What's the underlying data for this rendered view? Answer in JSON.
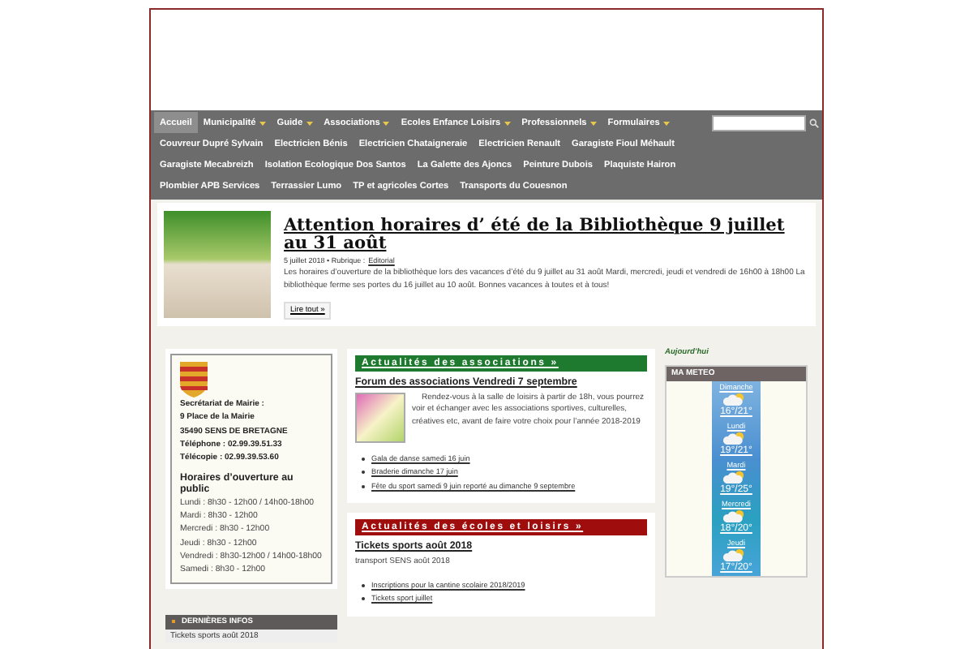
{
  "nav": {
    "rows": [
      {
        "items": [
          {
            "label": "Accueil",
            "dropdown": false,
            "selected": true
          },
          {
            "label": "Municipalité",
            "dropdown": true,
            "selected": false
          },
          {
            "label": "Guide",
            "dropdown": true,
            "selected": false
          },
          {
            "label": "Associations",
            "dropdown": true,
            "selected": false
          },
          {
            "label": "Ecoles Enfance Loisirs",
            "dropdown": true,
            "selected": false
          },
          {
            "label": "Professionnels",
            "dropdown": true,
            "selected": false
          },
          {
            "label": "Formulaires",
            "dropdown": true,
            "selected": false
          }
        ]
      },
      {
        "items": [
          {
            "label": "Couvreur Dupré Sylvain",
            "dropdown": false,
            "selected": false
          },
          {
            "label": "Electricien Bénis",
            "dropdown": false,
            "selected": false
          },
          {
            "label": "Electricien Chataigneraie",
            "dropdown": false,
            "selected": false
          },
          {
            "label": "Electricien Renault",
            "dropdown": false,
            "selected": false
          },
          {
            "label": "Garagiste Fioul Méhault",
            "dropdown": false,
            "selected": false
          }
        ]
      },
      {
        "items": [
          {
            "label": "Garagiste Mecabreizh",
            "dropdown": false,
            "selected": false
          },
          {
            "label": "Isolation Ecologique Dos Santos",
            "dropdown": false,
            "selected": false
          },
          {
            "label": "La Galette des Ajoncs",
            "dropdown": false,
            "selected": false
          },
          {
            "label": "Peinture Dubois",
            "dropdown": false,
            "selected": false
          },
          {
            "label": "Plaquiste Hairon",
            "dropdown": false,
            "selected": false
          }
        ]
      },
      {
        "items": [
          {
            "label": "Plombier APB Services",
            "dropdown": false,
            "selected": false
          },
          {
            "label": "Terrassier Lumo",
            "dropdown": false,
            "selected": false
          },
          {
            "label": "TP et agricoles Cortes",
            "dropdown": false,
            "selected": false
          },
          {
            "label": "Transports du Couesnon",
            "dropdown": false,
            "selected": false
          }
        ]
      }
    ]
  },
  "featured": {
    "title": "Attention horaires d’ été de la Bibliothèque 9 juillet au 31 août",
    "meta": "5 juillet 2018 • Rubrique :",
    "category": "Editorial",
    "excerpt": "Les horaires d’ouverture de la bibliothèque lors des vacances d’été du 9 juillet au 31 août Mardi, mercredi, jeudi et vendredi de 16h00 à 18h00 La bibliothèque ferme ses portes du 16 juillet au 10 août. Bonnes vacances à toutes et à tous!",
    "button": "Lire tout »"
  },
  "mairie": {
    "address": [
      "Secrétariat de Mairie :",
      "9 Place de la Mairie",
      "35490 SENS DE BRETAGNE",
      "Téléphone : 02.99.39.51.33",
      "Télécopie : 02.99.39.53.60"
    ],
    "hours_title": "Horaires d’ouverture au public",
    "hours": [
      "Lundi : 8h30 - 12h00 / 14h00-18h00",
      "Mardi : 8h30 - 12h00",
      "Mercredi : 8h30 - 12h00",
      "Jeudi : 8h30 - 12h00",
      "Vendredi : 8h30-12h00 / 14h00-18h00",
      "Samedi : 8h30 - 12h00"
    ]
  },
  "latest": {
    "title": "DERNIÈRES INFOS",
    "items": [
      "Tickets sports août 2018"
    ]
  },
  "sections": [
    {
      "heading": "Actualités des associations »",
      "color": "#1e7a2e",
      "post_title": "Forum des associations Vendredi 7 septembre",
      "has_image": true,
      "text": "Rendez-vous à la salle de loisirs à partir de 18h, vous pourrez voir et échanger avec les associations sportives, culturelles, créatives etc, avant de faire votre choix pour l’année 2018-2019",
      "links": [
        "Gala de danse samedi 16 juin",
        "Braderie dimanche 17 juin",
        "Fête du sport samedi 9 juin reporté au dimanche 9 septembre"
      ]
    },
    {
      "heading": "Actualités des écoles et loisirs »",
      "color": "#a00d0d",
      "post_title": "Tickets sports août 2018",
      "has_image": false,
      "text": "transport SENS août 2018",
      "links": [
        "Inscriptions pour la cantine scolaire 2018/2019",
        "Tickets sport juillet"
      ]
    }
  ],
  "today": "Aujourd’hui",
  "weather": {
    "title": "MA METEO",
    "days": [
      {
        "day": "Dimanche",
        "temps": "16°/21°"
      },
      {
        "day": "Lundi",
        "temps": "19°/21°"
      },
      {
        "day": "Mardi",
        "temps": "19°/25°"
      },
      {
        "day": "Mercredi",
        "temps": "18°/20°"
      },
      {
        "day": "Jeudi",
        "temps": "17°/20°"
      }
    ]
  }
}
